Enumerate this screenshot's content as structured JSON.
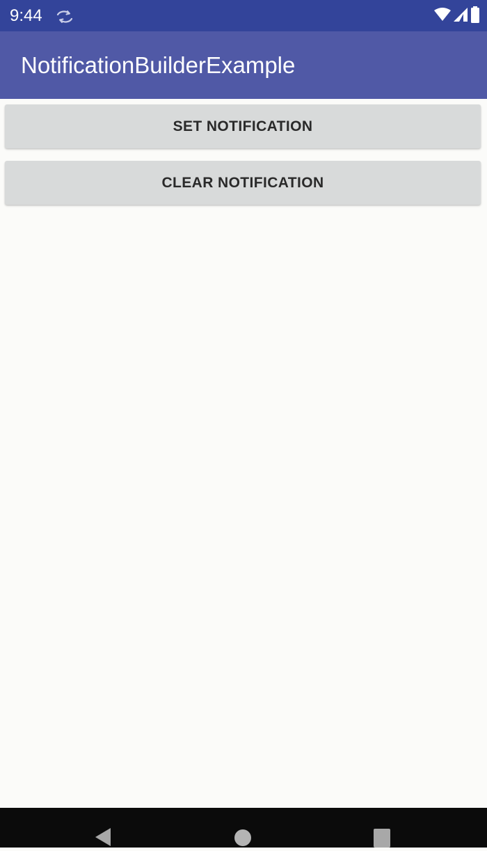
{
  "status_bar": {
    "time": "9:44",
    "icons": [
      "sync-icon",
      "wifi-icon",
      "cell-signal-icon",
      "battery-icon"
    ],
    "background": "#33449a"
  },
  "app_bar": {
    "title": "NotificationBuilderExample",
    "background": "#5059a6"
  },
  "buttons": {
    "set_label": "SET NOTIFICATION",
    "clear_label": "CLEAR NOTIFICATION",
    "background": "#d8dada"
  },
  "nav_bar": {
    "icons": [
      "back-icon",
      "home-icon",
      "recents-icon"
    ],
    "background": "#0b0b0b"
  }
}
